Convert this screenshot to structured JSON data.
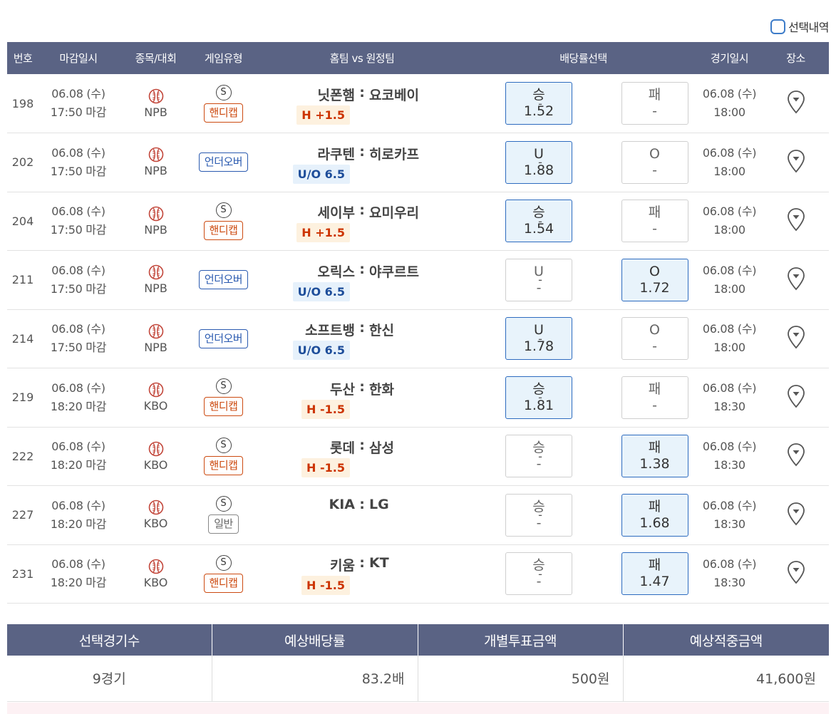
{
  "select_history": {
    "label": "선택내역"
  },
  "headers": {
    "no": "번호",
    "deadline": "마감일시",
    "sport": "종목/대회",
    "gametype": "게임유형",
    "teams": "홈팀 vs 원정팀",
    "odds": "배당률선택",
    "gamedate": "경기일시",
    "venue": "장소"
  },
  "rows": [
    {
      "no": "198",
      "deadline_date": "06.08 (수)",
      "deadline_time": "17:50 마감",
      "league": "NPB",
      "special": "S",
      "type_label": "핸디캡",
      "type_kind": "handi",
      "home": "닛폰햄",
      "colon": ":",
      "away": "요코베이",
      "sub": "H +1.5",
      "sub_kind": "h",
      "odd1_label": "승",
      "odd1_value": "1.52",
      "odd1_selected": true,
      "draw": "-",
      "odd2_label": "패",
      "odd2_value": "-",
      "odd2_selected": false,
      "game_date": "06.08 (수)",
      "game_time": "18:00"
    },
    {
      "no": "202",
      "deadline_date": "06.08 (수)",
      "deadline_time": "17:50 마감",
      "league": "NPB",
      "special": "",
      "type_label": "언더오버",
      "type_kind": "ou",
      "home": "라쿠텐",
      "colon": ":",
      "away": "히로카프",
      "sub": "U/O 6.5",
      "sub_kind": "uo",
      "odd1_label": "U",
      "odd1_value": "1.88",
      "odd1_selected": true,
      "draw": "-",
      "odd2_label": "O",
      "odd2_value": "-",
      "odd2_selected": false,
      "game_date": "06.08 (수)",
      "game_time": "18:00"
    },
    {
      "no": "204",
      "deadline_date": "06.08 (수)",
      "deadline_time": "17:50 마감",
      "league": "NPB",
      "special": "S",
      "type_label": "핸디캡",
      "type_kind": "handi",
      "home": "세이부",
      "colon": ":",
      "away": "요미우리",
      "sub": "H +1.5",
      "sub_kind": "h",
      "odd1_label": "승",
      "odd1_value": "1.54",
      "odd1_selected": true,
      "draw": "-",
      "odd2_label": "패",
      "odd2_value": "-",
      "odd2_selected": false,
      "game_date": "06.08 (수)",
      "game_time": "18:00"
    },
    {
      "no": "211",
      "deadline_date": "06.08 (수)",
      "deadline_time": "17:50 마감",
      "league": "NPB",
      "special": "",
      "type_label": "언더오버",
      "type_kind": "ou",
      "home": "오릭스",
      "colon": ":",
      "away": "야쿠르트",
      "sub": "U/O 6.5",
      "sub_kind": "uo",
      "odd1_label": "U",
      "odd1_value": "-",
      "odd1_selected": false,
      "draw": "-",
      "odd2_label": "O",
      "odd2_value": "1.72",
      "odd2_selected": true,
      "game_date": "06.08 (수)",
      "game_time": "18:00"
    },
    {
      "no": "214",
      "deadline_date": "06.08 (수)",
      "deadline_time": "17:50 마감",
      "league": "NPB",
      "special": "",
      "type_label": "언더오버",
      "type_kind": "ou",
      "home": "소프트뱅",
      "colon": ":",
      "away": "한신",
      "sub": "U/O 6.5",
      "sub_kind": "uo",
      "odd1_label": "U",
      "odd1_value": "1.78",
      "odd1_selected": true,
      "draw": "-",
      "odd2_label": "O",
      "odd2_value": "-",
      "odd2_selected": false,
      "game_date": "06.08 (수)",
      "game_time": "18:00"
    },
    {
      "no": "219",
      "deadline_date": "06.08 (수)",
      "deadline_time": "18:20 마감",
      "league": "KBO",
      "special": "S",
      "type_label": "핸디캡",
      "type_kind": "handi",
      "home": "두산",
      "colon": ":",
      "away": "한화",
      "sub": "H -1.5",
      "sub_kind": "h",
      "odd1_label": "승",
      "odd1_value": "1.81",
      "odd1_selected": true,
      "draw": "-",
      "odd2_label": "패",
      "odd2_value": "-",
      "odd2_selected": false,
      "game_date": "06.08 (수)",
      "game_time": "18:30"
    },
    {
      "no": "222",
      "deadline_date": "06.08 (수)",
      "deadline_time": "18:20 마감",
      "league": "KBO",
      "special": "S",
      "type_label": "핸디캡",
      "type_kind": "handi",
      "home": "롯데",
      "colon": ":",
      "away": "삼성",
      "sub": "H -1.5",
      "sub_kind": "h",
      "odd1_label": "승",
      "odd1_value": "-",
      "odd1_selected": false,
      "draw": "-",
      "odd2_label": "패",
      "odd2_value": "1.38",
      "odd2_selected": true,
      "game_date": "06.08 (수)",
      "game_time": "18:30"
    },
    {
      "no": "227",
      "deadline_date": "06.08 (수)",
      "deadline_time": "18:20 마감",
      "league": "KBO",
      "special": "S",
      "type_label": "일반",
      "type_kind": "normal",
      "home": "KIA",
      "colon": ":",
      "away": "LG",
      "sub": "",
      "sub_kind": "",
      "odd1_label": "승",
      "odd1_value": "-",
      "odd1_selected": false,
      "draw": "-",
      "odd2_label": "패",
      "odd2_value": "1.68",
      "odd2_selected": true,
      "game_date": "06.08 (수)",
      "game_time": "18:30"
    },
    {
      "no": "231",
      "deadline_date": "06.08 (수)",
      "deadline_time": "18:20 마감",
      "league": "KBO",
      "special": "S",
      "type_label": "핸디캡",
      "type_kind": "handi",
      "home": "키움",
      "colon": ":",
      "away": "KT",
      "sub": "H -1.5",
      "sub_kind": "h",
      "odd1_label": "승",
      "odd1_value": "-",
      "odd1_selected": false,
      "draw": "-",
      "odd2_label": "패",
      "odd2_value": "1.47",
      "odd2_selected": true,
      "game_date": "06.08 (수)",
      "game_time": "18:30"
    }
  ],
  "summary": {
    "headers": [
      "선택경기수",
      "예상배당률",
      "개별투표금액",
      "예상적중금액"
    ],
    "values": [
      "9경기",
      "83.2배",
      "500원",
      "41,600원"
    ]
  },
  "colors": {
    "header_bg": "#5a6384",
    "selected_bg": "#e8f3fb",
    "selected_border": "#2d6bbf",
    "handicap": "#cc4a10",
    "underover": "#2a5ab0"
  },
  "icons": {
    "sport": "baseball-icon",
    "venue": "map-pin-icon",
    "special": "special-s-icon"
  }
}
